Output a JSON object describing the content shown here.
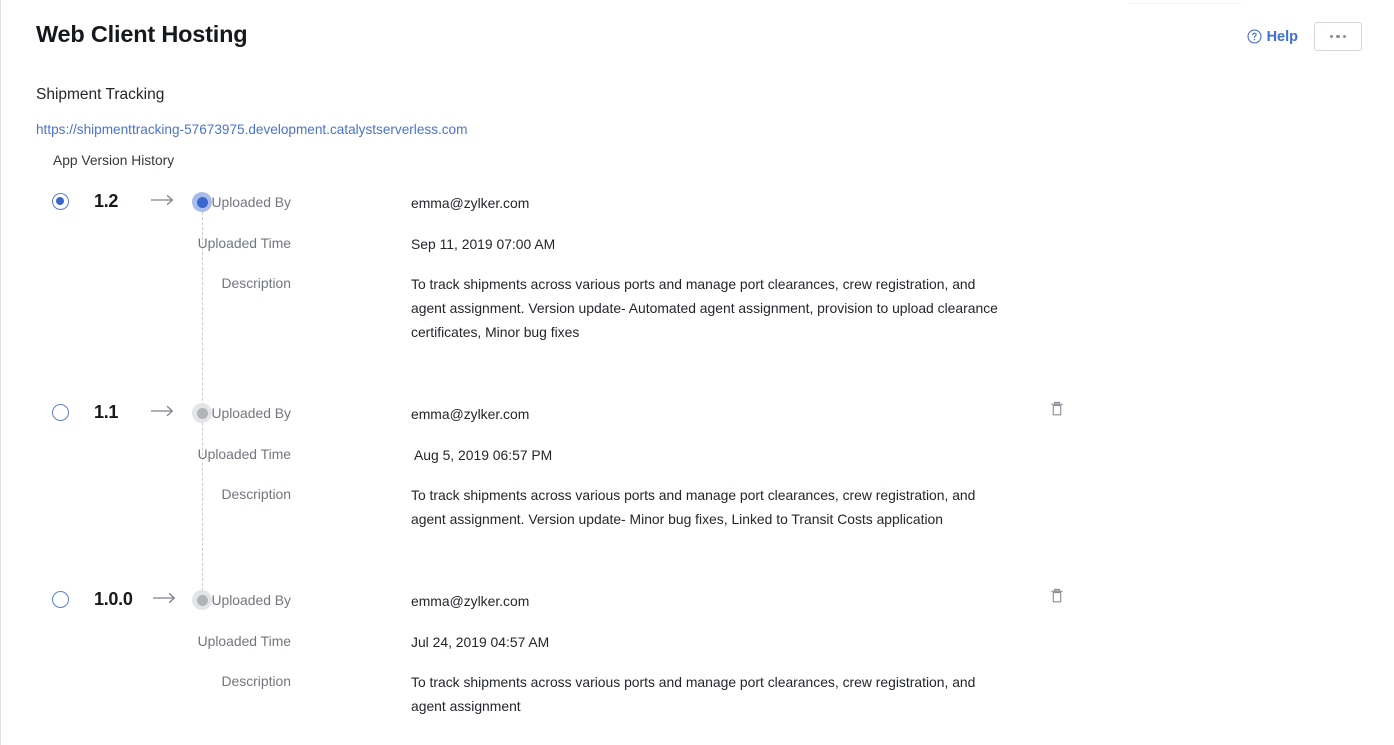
{
  "header": {
    "title": "Web Client Hosting",
    "help_label": "Help",
    "help_icon": "question-circle-icon",
    "more_icon": "ellipsis-icon"
  },
  "app": {
    "name": "Shipment Tracking",
    "url": "https://shipmenttracking-57673975.development.catalystserverless.com",
    "history_label": "App Version History"
  },
  "labels": {
    "uploaded_by": "Uploaded By",
    "uploaded_time": "Uploaded Time",
    "description": "Description"
  },
  "colors": {
    "accent": "#3a67cf",
    "link": "#4a72d4",
    "muted": "#72767e",
    "border": "#e2e2e2"
  },
  "versions": [
    {
      "number": "1.2",
      "selected": true,
      "active": true,
      "deletable": false,
      "uploaded_by": "emma@zylker.com",
      "uploaded_time": "Sep 11, 2019 07:00 AM",
      "time_indented": false,
      "description": "To track shipments across various ports and manage port clearances, crew registration, and agent assignment. Version update- Automated agent assignment, provision to upload clearance certificates, Minor bug fixes"
    },
    {
      "number": "1.1",
      "selected": false,
      "active": false,
      "deletable": true,
      "uploaded_by": "emma@zylker.com",
      "uploaded_time": "Aug 5, 2019 06:57 PM",
      "time_indented": true,
      "description": "To track shipments across various ports and manage port clearances, crew registration, and agent assignment. Version update- Minor bug fixes, Linked to Transit Costs application"
    },
    {
      "number": "1.0.0",
      "selected": false,
      "active": false,
      "deletable": true,
      "uploaded_by": "emma@zylker.com",
      "uploaded_time": "Jul 24, 2019 04:57 AM",
      "time_indented": false,
      "description": "To track shipments across various ports and manage port clearances, crew registration, and agent assignment"
    }
  ]
}
